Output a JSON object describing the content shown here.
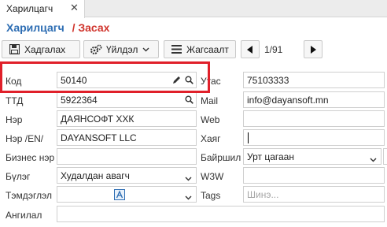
{
  "tabs": [
    {
      "label": "Харилцагч",
      "close": "✕"
    }
  ],
  "breadcrumb": {
    "main": "Харилцагч",
    "separator": "/",
    "sub": "Засах"
  },
  "toolbar": {
    "save_label": "Хадгалах",
    "actions_label": "Үйлдэл",
    "list_label": "Жагсаалт",
    "pager": "1/91"
  },
  "form": {
    "code": {
      "label": "Код",
      "value": "50140"
    },
    "vat": {
      "label": "Утас",
      "value": "75103333"
    },
    "tin": {
      "label": "ТТД",
      "value": "5922364"
    },
    "mail": {
      "label": "Mail",
      "value": "info@dayansoft.mn"
    },
    "name": {
      "label": "Нэр",
      "value": "ДАЯНСОФТ ХХК"
    },
    "web": {
      "label": "Web",
      "value": ""
    },
    "name_en": {
      "label": "Нэр /EN/",
      "value": "DAYANSOFT LLC"
    },
    "address": {
      "label": "Хаяг",
      "value": ""
    },
    "business_name": {
      "label": "Бизнес нэр",
      "value": ""
    },
    "location": {
      "label": "Байршил",
      "value": "Урт цагаан"
    },
    "group": {
      "label": "Бүлэг",
      "value": "Худалдан авагч"
    },
    "w3w": {
      "label": "W3W",
      "value": ""
    },
    "supporter": {
      "label": "Тэмдэглэл",
      "value": ""
    },
    "tags": {
      "label": "Tags",
      "placeholder": "Шинэ..."
    },
    "category": {
      "label": "Ангилал",
      "value": ""
    }
  },
  "colors": {
    "accent_blue": "#2d6db3",
    "accent_red": "#d0342c",
    "highlight_red": "#e0202a"
  }
}
